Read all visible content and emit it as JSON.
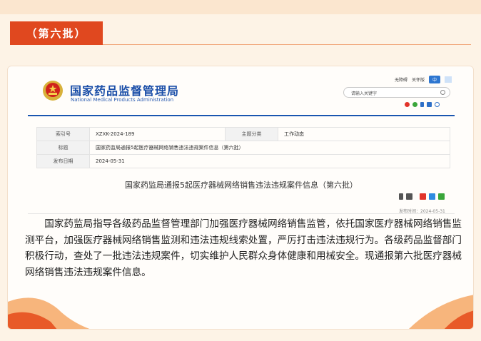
{
  "section_badge": "（第六批）",
  "site": {
    "org_name_cn": "国家药品监督管理局",
    "org_name_en": "National Medical Products Administration",
    "top_links": [
      "无障碍",
      "关怀版"
    ],
    "lang_label": "中",
    "search_placeholder": "请输入关键字",
    "social_icons": [
      "weibo-icon",
      "wechat-icon",
      "mobile-icon",
      "mail-icon",
      "user-icon"
    ]
  },
  "meta": {
    "index_label": "索引号",
    "index_value": "XZXK-2024-189",
    "category_label": "主题分类",
    "category_value": "工作动态",
    "title_label": "标题",
    "title_value": "国家药监局通报5起医疗器械网络销售违法违规案件信息（第六批）",
    "date_label": "发布日期",
    "date_value": "2024-05-31"
  },
  "article": {
    "title": "国家药监局通报5起医疗器械网络销售违法违规案件信息（第六批）",
    "published": "发布时间：2024-05-31",
    "body": "国家药监局指导各级药品监督管理部门加强医疗器械网络销售监管，依托国家医疗器械网络销售监测平台，加强医疗器械网络销售监测和违法违规线索处置，严厉打击违法违规行为。各级药品监督部门积极行动，查处了一批违法违规案件，切实维护人民群众身体健康和用械安全。现通报第六批医疗器械网络销售违法违规案件信息。"
  },
  "colors": {
    "badge": "#e0481f",
    "brand_blue": "#1a4ea8",
    "background": "#fdf3e6"
  }
}
